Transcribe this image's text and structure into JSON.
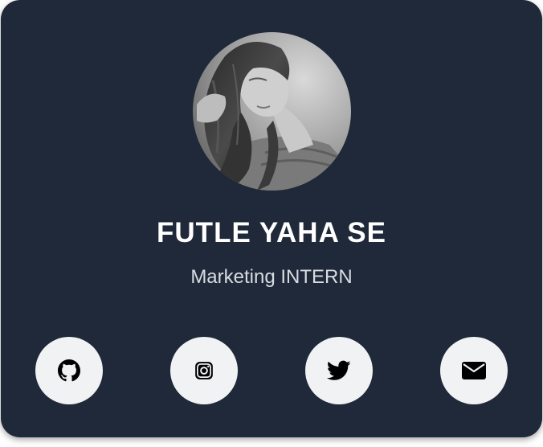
{
  "profile": {
    "name": "FUTLE YAHA SE",
    "role": "Marketing INTERN",
    "avatar": "profile-photo"
  },
  "social_links": [
    {
      "icon": "github-icon"
    },
    {
      "icon": "instagram-icon"
    },
    {
      "icon": "twitter-icon"
    },
    {
      "icon": "email-icon"
    }
  ],
  "colors": {
    "card_background": "#202939",
    "name_text": "#ffffff",
    "role_text": "#d8dce2",
    "button_background": "#f1f2f4",
    "icon_color": "#000000"
  }
}
